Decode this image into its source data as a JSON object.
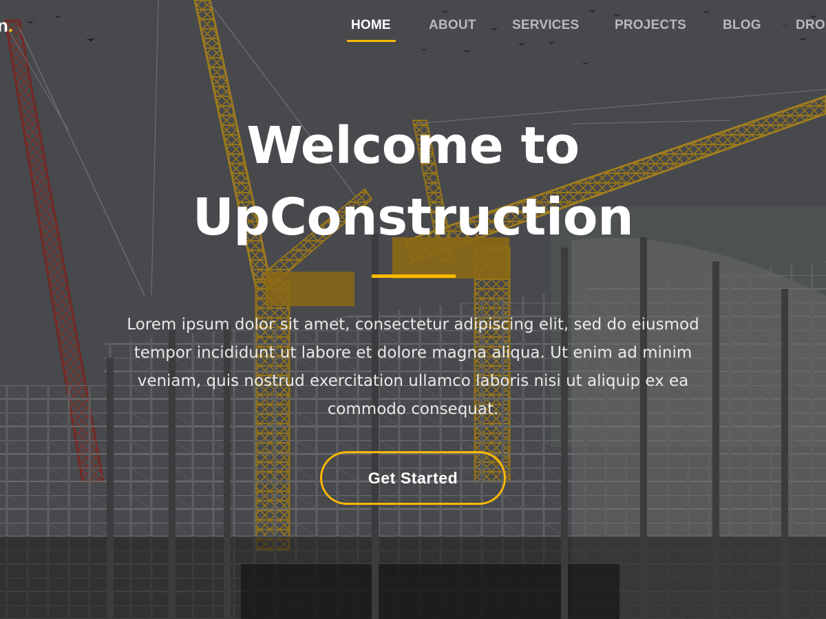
{
  "brand": {
    "logo_text": "n",
    "logo_dot": ".",
    "accent_color": "#feb900"
  },
  "nav": {
    "items": [
      {
        "label": "HOME",
        "active": true
      },
      {
        "label": "ABOUT",
        "active": false
      },
      {
        "label": "SERVICES",
        "active": false
      },
      {
        "label": "PROJECTS",
        "active": false
      },
      {
        "label": "BLOG",
        "active": false
      },
      {
        "label": "DROP",
        "active": false
      }
    ]
  },
  "hero": {
    "title_line1": "Welcome to",
    "title_line2": "UpConstruction",
    "description": "Lorem ipsum dolor sit amet, consectetur adipiscing elit, sed do eiusmod tempor incididunt ut labore et dolore magna aliqua. Ut enim ad minim veniam, quis nostrud exercitation ullamco laboris nisi ut aliquip ex ea commodo consequat.",
    "cta_label": "Get Started",
    "background": "construction-site-cranes-photo"
  }
}
